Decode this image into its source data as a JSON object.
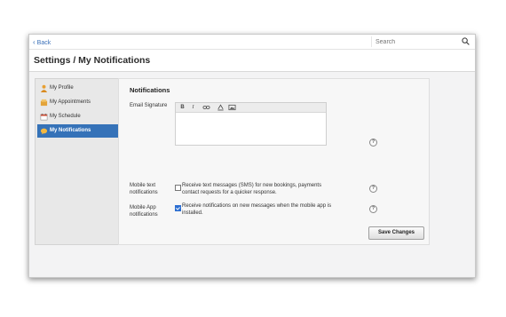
{
  "topbar": {
    "back_label": "Back",
    "search_placeholder": "Search"
  },
  "header": {
    "title": "Settings / My Notifications"
  },
  "sidebar": {
    "items": [
      {
        "label": "My Profile",
        "icon": "profile-icon",
        "active": false
      },
      {
        "label": "My Appointments",
        "icon": "appointments-icon",
        "active": false
      },
      {
        "label": "My Schedule",
        "icon": "calendar-icon",
        "active": false
      },
      {
        "label": "My Notifications",
        "icon": "notifications-icon",
        "active": true
      }
    ]
  },
  "main": {
    "section_title": "Notifications",
    "email_signature": {
      "label": "Email Signature",
      "toolbar": [
        "B",
        "I",
        "link",
        "A",
        "image"
      ],
      "value": ""
    },
    "mobile_text": {
      "label": "Mobile text notifications",
      "checked": false,
      "text": "Receive text messages (SMS) for new bookings, payments contact requests for a quicker response."
    },
    "mobile_app": {
      "label": "Mobile App notifications",
      "checked": true,
      "text": "Receive notifications on new messages when the mobile app is installed."
    },
    "help_symbol": "?",
    "save_label": "Save Changes"
  },
  "colors": {
    "accent": "#3572b8",
    "link": "#3a70b8",
    "checkbox": "#2d6fd1"
  }
}
